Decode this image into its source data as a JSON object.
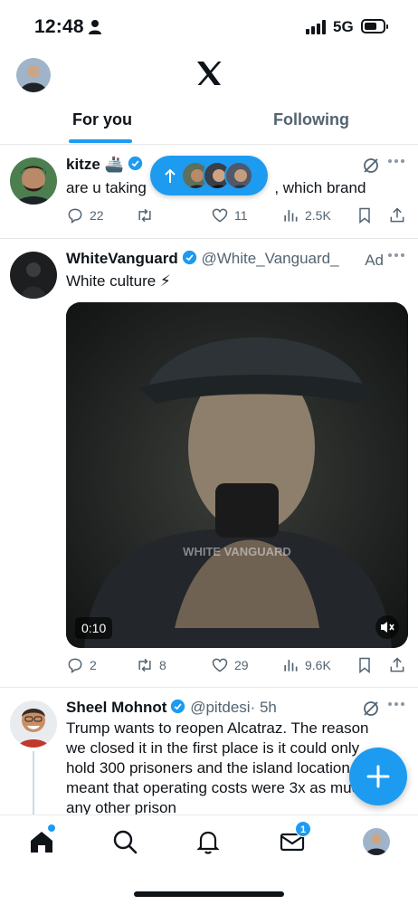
{
  "status_bar": {
    "time": "12:48",
    "network": "5G"
  },
  "header": {
    "logo": "x-logo",
    "tabs": [
      {
        "label": "For you",
        "active": true
      },
      {
        "label": "Following",
        "active": false
      }
    ]
  },
  "new_posts_pill": {
    "icon": "arrow-up-icon"
  },
  "posts": [
    {
      "name": "kitze",
      "name_emoji": "🚢",
      "text_start": "are u taking",
      "text_end": ", which brand",
      "actions": {
        "replies": "22",
        "reposts": "",
        "likes": "11",
        "views": "2.5K"
      }
    },
    {
      "name": "WhiteVanguard",
      "handle": "@White_Vanguard_",
      "ad_label": "Ad",
      "text": "White culture ⚡",
      "video": {
        "duration": "0:10",
        "watermark": "WHITE VANGUARD"
      },
      "actions": {
        "replies": "2",
        "reposts": "8",
        "likes": "29",
        "views": "9.6K"
      }
    },
    {
      "name": "Sheel Mohnot",
      "handle": "@pitdesi",
      "time": "· 5h",
      "lines": [
        "Trump wants to reopen Alcatraz. The reason",
        "we closed it in the first place is it could only",
        "hold 300 prisoners and the island location",
        "meant that operating costs were 3x as much as",
        "any other prison"
      ]
    }
  ],
  "bottom_nav": {
    "messages_badge": "1"
  },
  "colors": {
    "accent": "#1d9bf0",
    "text": "#0f1419",
    "muted": "#536471"
  }
}
